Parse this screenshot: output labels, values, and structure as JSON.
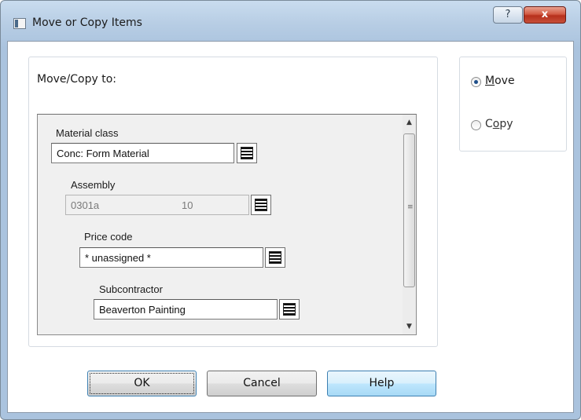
{
  "window": {
    "title": "Move or Copy Items",
    "help_button": "?",
    "close_button": "x"
  },
  "move_copy_group": {
    "label": "Move/Copy to:",
    "fields": {
      "material_class": {
        "label": "Material class",
        "value": "Conc: Form Material"
      },
      "assembly": {
        "label": "Assembly",
        "value": "0301a",
        "extra": "10"
      },
      "price_code": {
        "label": "Price code",
        "value": "* unassigned *"
      },
      "subcontractor": {
        "label": "Subcontractor",
        "value": "Beaverton Painting"
      }
    }
  },
  "mode": {
    "move": {
      "first": "M",
      "rest": "ove",
      "checked": true
    },
    "copy": {
      "first": "C",
      "underlined": "o",
      "rest": "py",
      "checked": false
    }
  },
  "buttons": {
    "ok": "OK",
    "cancel": "Cancel",
    "help": "Help"
  },
  "icons": {
    "window_icon": "window-icon",
    "picker": "list-picker-icon",
    "scroll_up": "▲",
    "scroll_down": "▼",
    "grip": "≡"
  },
  "colors": {
    "title_gradient": "#b7cde4",
    "close_button": "#c7503a",
    "focus_blue": "#3c7fb1"
  }
}
